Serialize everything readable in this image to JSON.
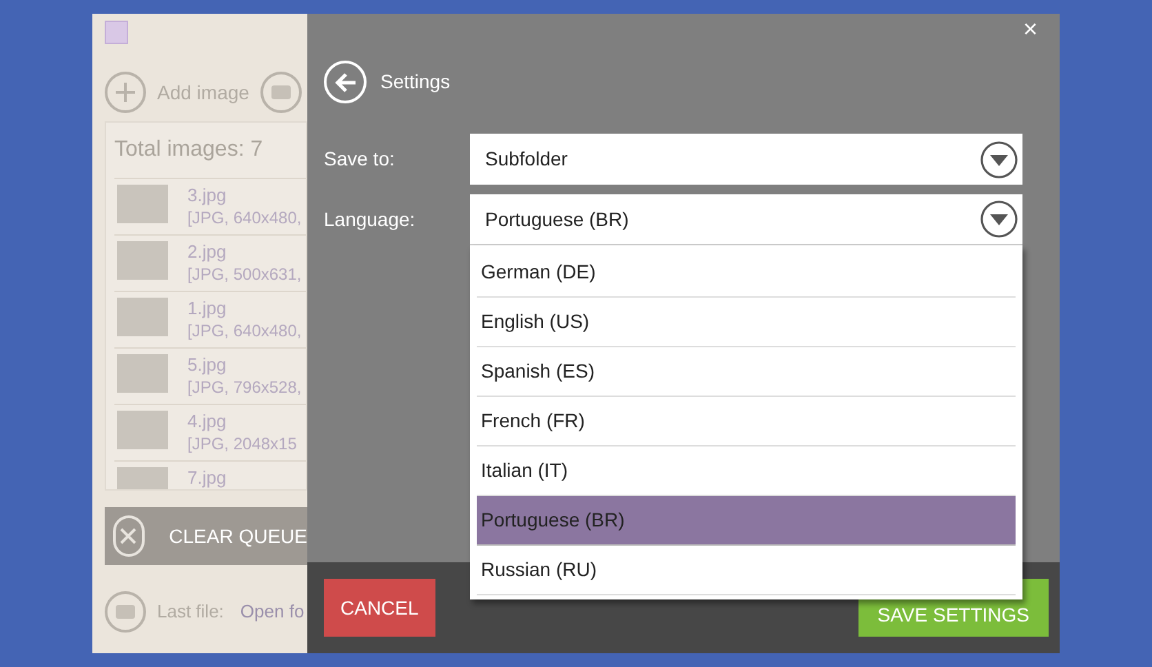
{
  "app": {
    "add_image": "Add image",
    "total_images": "Total images: 7",
    "images": [
      {
        "name": "3.jpg",
        "info": "[JPG, 640x480,"
      },
      {
        "name": "2.jpg",
        "info": "[JPG, 500x631,"
      },
      {
        "name": "1.jpg",
        "info": "[JPG, 640x480,"
      },
      {
        "name": "5.jpg",
        "info": "[JPG, 796x528,"
      },
      {
        "name": "4.jpg",
        "info": "[JPG, 2048x15"
      },
      {
        "name": "7.jpg"
      }
    ],
    "clear_queue": "CLEAR QUEUE",
    "last_file_label": "Last file:",
    "last_file_value": "Open fo"
  },
  "settings": {
    "close": "×",
    "title": "Settings",
    "fields": [
      {
        "label": "Save to:",
        "value": "Subfolder",
        "expanded": false
      },
      {
        "label": "Language:",
        "value": "Portuguese (BR)",
        "expanded": true
      }
    ],
    "language_options": [
      {
        "label": "German (DE)",
        "selected": false
      },
      {
        "label": "English (US)",
        "selected": false
      },
      {
        "label": "Spanish (ES)",
        "selected": false
      },
      {
        "label": "French (FR)",
        "selected": false
      },
      {
        "label": "Italian (IT)",
        "selected": false
      },
      {
        "label": "Portuguese (BR)",
        "selected": true
      },
      {
        "label": "Russian (RU)",
        "selected": false
      }
    ],
    "buttons": {
      "cancel": "CANCEL",
      "save": "SAVE SETTINGS"
    }
  }
}
